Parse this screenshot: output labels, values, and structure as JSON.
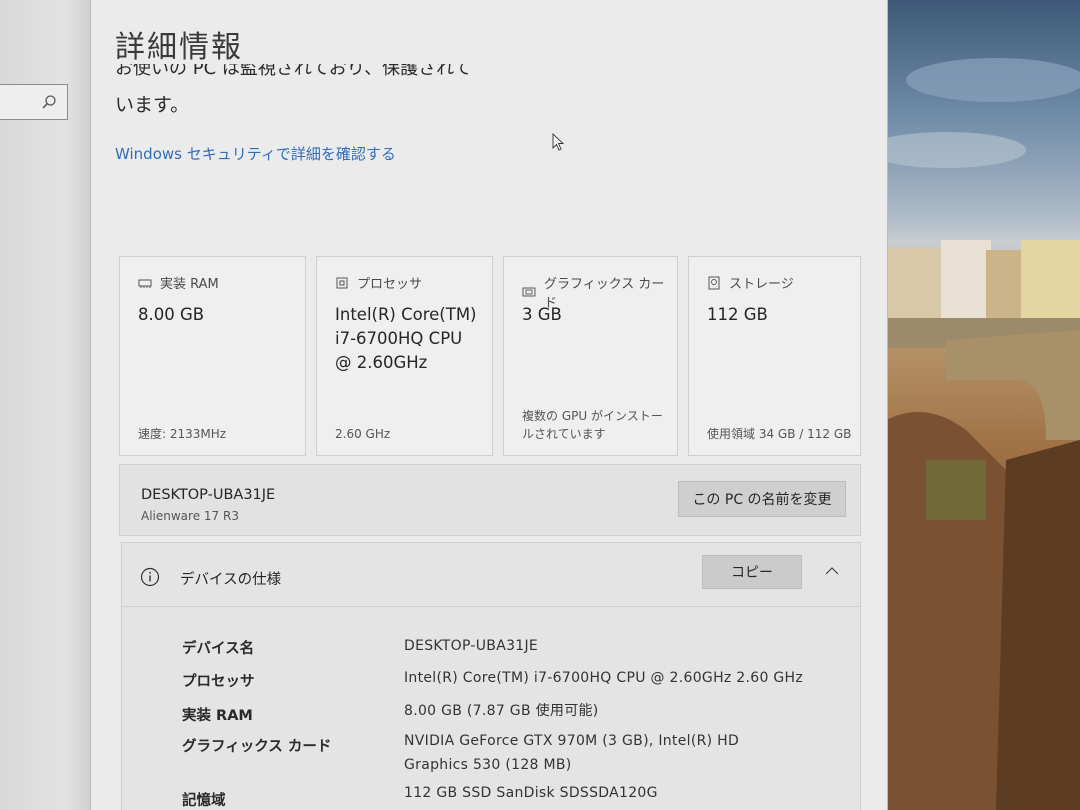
{
  "window": {
    "title": "詳細情報",
    "protection_text_line1": "お使いの PC は監視されており、保護されて",
    "protection_text_line2": "います。",
    "security_link": "Windows セキュリティで詳細を確認する"
  },
  "cards": [
    {
      "label": "実装 RAM",
      "icon": "memory-icon",
      "value": "8.00 GB",
      "note": "速度: 2133MHz"
    },
    {
      "label": "プロセッサ",
      "icon": "processor-icon",
      "value": "Intel(R) Core(TM) i7-6700HQ CPU @ 2.60GHz",
      "note": "2.60 GHz"
    },
    {
      "label": "グラフィックス カード",
      "icon": "graphics-card-icon",
      "value": "3 GB",
      "note": "複数の GPU がインストールされています"
    },
    {
      "label": "ストレージ",
      "icon": "storage-icon",
      "value": "112 GB",
      "note": "使用領域 34 GB / 112 GB"
    }
  ],
  "device": {
    "name": "DESKTOP-UBA31JE",
    "model": "Alienware 17 R3",
    "rename_button": "この PC の名前を変更"
  },
  "specs": {
    "title": "デバイスの仕様",
    "copy_button": "コピー",
    "rows": [
      {
        "label": "デバイス名",
        "value": "DESKTOP-UBA31JE"
      },
      {
        "label": "プロセッサ",
        "value": "Intel(R) Core(TM) i7-6700HQ CPU @ 2.60GHz   2.60 GHz"
      },
      {
        "label": "実装 RAM",
        "value": "8.00 GB (7.87 GB 使用可能)"
      },
      {
        "label": "グラフィックス カード",
        "value": "NVIDIA GeForce GTX 970M (3 GB), Intel(R) HD Graphics 530 (128 MB)"
      },
      {
        "label": "記憶域",
        "value": "112 GB SSD SanDisk SDSSDA120G"
      }
    ]
  },
  "colors": {
    "link": "#2f6dba",
    "window_bg": "#ebebeb",
    "button_bg": "#cfcfcf"
  }
}
